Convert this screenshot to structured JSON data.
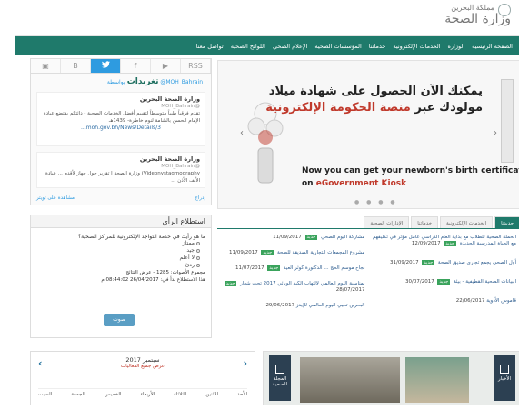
{
  "header": {
    "logo_line1": "مملكة البحرين",
    "logo_line2": "وزارة الصحة"
  },
  "nav": {
    "items": [
      "الصفحة الرئيسية",
      "الوزارة",
      "الخدمات الإلكترونية",
      "خدماتنا",
      "المؤسسات الصحية",
      "الإعلام الصحي",
      "اللوائح الصحية",
      "تواصل معنا"
    ]
  },
  "social": {
    "tabs": [
      "▣",
      "B",
      "🐦",
      "f",
      "▶",
      "RSS"
    ],
    "title": "تغريدات",
    "title_by": "بواسطة @MOH_Bahrain",
    "tweets": [
      {
        "who": "وزارة الصحة البحرين",
        "handle": "@MOH_Bahrain",
        "text": "تقدم فرقياً طبياً متوسطاً لتقييم أفضل الخدمات الصحية - دائتكم يقتضع عبادة الإمام الحسن بالشامة لنوم خاطرة- 1439هـ",
        "link": "moh.gov.bh/News/Details/3..."
      },
      {
        "who": "وزارة الصحة البحرين",
        "handle": "@MOH_Bahrain",
        "text": "Videonystagmography) وزارة الصحة ا تقرير حول جهاز  لأقدم ... عيادة الأنف الأذن ..."
      }
    ],
    "footer_left": "مشاهدة على تويتر",
    "footer_right": "إدراج"
  },
  "poll": {
    "title": "استطلاع الرأي",
    "question": "ما هو رأيك في خدمة التواجد الإلكترونية للمراكز الصحية؟",
    "options": [
      "ممتاز",
      "جيد",
      "لا أعلم",
      "ردئ"
    ],
    "total": "مجموع الأصوات: 1285 - عرض النتائج",
    "ends": "هذا الاستطلاع بدأ في: 26/04/2017 08:44:02 م",
    "vote_label": "صوت"
  },
  "calendar": {
    "month": "2017 سبتمبر",
    "all_events": "عرض جميع الفعاليات",
    "days": [
      "الأحد",
      "الاثنين",
      "الثلاثاء",
      "الأربعاء",
      "الخميس",
      "الجمعة",
      "السبت"
    ]
  },
  "slider": {
    "ar_line1": "يمكنك الآن الحصول على شهادة ميلاد",
    "ar_line2_plain": "مولودك عبر",
    "ar_line2_red": "منصة الحكومة الإلكترونية",
    "en_line1": "Now you can get your newborn's birth certificate",
    "en_line2_plain": "on",
    "en_line2_red": "eGovernment Kiosk",
    "prev": "‹",
    "next": "›",
    "dots": "● ● ● ●"
  },
  "news": {
    "tabs": [
      "جديدنا",
      "الخدمات الإلكترونية",
      "خدماتنا",
      "الإدارات الصحية"
    ],
    "right_col": [
      {
        "title": "الحملة الصحية للطلاب مع بداية العام الدراسي عامل مؤثر في تكليفهم مع الحياة المدرسية الجديدة",
        "date": "12/09/2017"
      },
      {
        "title": "أول الصحي يجمع تجاري صديق الصحة",
        "date": "31/09/2017"
      },
      {
        "title": "البيانات الصحية القطيفية - بيئة",
        "date": "30/07/2017"
      },
      {
        "title": "قاموس الأدوية",
        "date": "22/06/2017"
      }
    ],
    "mid_col": [
      {
        "title": "مشاركة اليوم الصحي",
        "date": "11/09/2017"
      },
      {
        "title": "مشروع المجمعات التجارية الصديقة للصحة",
        "date": "11/09/2017"
      },
      {
        "title": "نجاح موسم الحج ... الدكتورة كوثر العيد",
        "date": "11/07/2017"
      },
      {
        "title": "بمناسبة اليوم العالمي لالتهاب الكبد الوبائي 2017 تحت شعار",
        "date": "28/07/2017"
      },
      {
        "title": "البحرين تحيي اليوم العالمي للإيدز",
        "date": "29/06/2017"
      }
    ],
    "tag": "جديد"
  },
  "bottom": {
    "mag_label": "المجلة الصحية",
    "news_label": "الأخبار"
  }
}
